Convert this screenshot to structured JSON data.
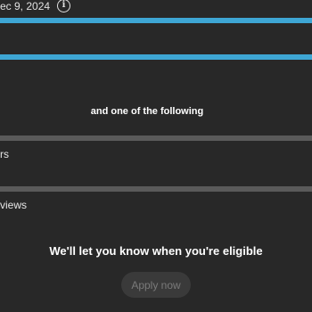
{
  "header": {
    "date_text": "ec 9, 2024",
    "info_icon": "info-icon"
  },
  "progress": {
    "bar1_fraction": 1.0,
    "bar2_fraction": 1.0,
    "bar1_color": "#3ea6d4",
    "bar2_color": "#3ea6d4",
    "bar3_fraction": 1.0,
    "bar4_fraction": 1.0,
    "bar3_color": "#5a5a5a",
    "bar4_color": "#5a5a5a"
  },
  "requirements": {
    "heading": "and one of the following",
    "item1_label": "rs",
    "item2_label": "views"
  },
  "footer": {
    "eligible_message": "We'll let you know when you're eligible",
    "apply_label": "Apply now"
  }
}
